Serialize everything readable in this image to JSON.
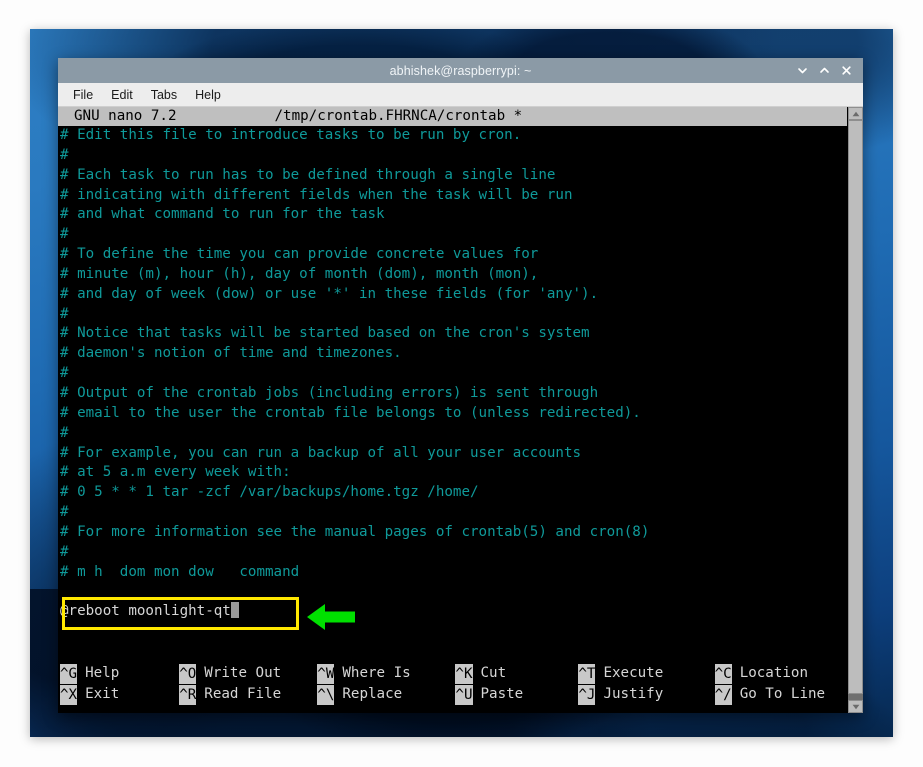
{
  "window": {
    "title": "abhishek@raspberrypi: ~",
    "controls": {
      "minimize": "chevron-down",
      "maximize": "chevron-up",
      "close": "×"
    }
  },
  "menubar": {
    "items": [
      {
        "label": "File"
      },
      {
        "label": "Edit"
      },
      {
        "label": "Tabs"
      },
      {
        "label": "Help"
      }
    ]
  },
  "nano": {
    "version": "GNU nano 7.2",
    "filename": "/tmp/crontab.FHRNCA/crontab *",
    "lines": [
      {
        "text": "# Edit this file to introduce tasks to be run by cron.",
        "style": "comment"
      },
      {
        "text": "#",
        "style": "comment"
      },
      {
        "text": "# Each task to run has to be defined through a single line",
        "style": "comment"
      },
      {
        "text": "# indicating with different fields when the task will be run",
        "style": "comment"
      },
      {
        "text": "# and what command to run for the task",
        "style": "comment"
      },
      {
        "text": "#",
        "style": "comment"
      },
      {
        "text": "# To define the time you can provide concrete values for",
        "style": "comment"
      },
      {
        "text": "# minute (m), hour (h), day of month (dom), month (mon),",
        "style": "comment"
      },
      {
        "text": "# and day of week (dow) or use '*' in these fields (for 'any').",
        "style": "comment"
      },
      {
        "text": "#",
        "style": "comment"
      },
      {
        "text": "# Notice that tasks will be started based on the cron's system",
        "style": "comment"
      },
      {
        "text": "# daemon's notion of time and timezones.",
        "style": "comment"
      },
      {
        "text": "#",
        "style": "comment"
      },
      {
        "text": "# Output of the crontab jobs (including errors) is sent through",
        "style": "comment"
      },
      {
        "text": "# email to the user the crontab file belongs to (unless redirected).",
        "style": "comment"
      },
      {
        "text": "#",
        "style": "comment"
      },
      {
        "text": "# For example, you can run a backup of all your user accounts",
        "style": "comment"
      },
      {
        "text": "# at 5 a.m every week with:",
        "style": "comment"
      },
      {
        "text": "# 0 5 * * 1 tar -zcf /var/backups/home.tgz /home/",
        "style": "comment"
      },
      {
        "text": "#",
        "style": "comment"
      },
      {
        "text": "# For more information see the manual pages of crontab(5) and cron(8)",
        "style": "comment"
      },
      {
        "text": "#",
        "style": "comment"
      },
      {
        "text": "# m h  dom mon dow   command",
        "style": "comment"
      },
      {
        "text": "",
        "style": "comment"
      },
      {
        "text": "@reboot moonlight-qt",
        "style": "cmd",
        "cursor": true
      }
    ],
    "shortcuts": [
      {
        "key": "^G",
        "label": "Help",
        "col": "g"
      },
      {
        "key": "^O",
        "label": "Write Out",
        "col": "o"
      },
      {
        "key": "^W",
        "label": "Where Is",
        "col": "w"
      },
      {
        "key": "^K",
        "label": "Cut",
        "col": "k"
      },
      {
        "key": "^T",
        "label": "Execute",
        "col": "t"
      },
      {
        "key": "^C",
        "label": "Location",
        "col": "c"
      },
      {
        "key": "^X",
        "label": "Exit",
        "col": "g"
      },
      {
        "key": "^R",
        "label": "Read File",
        "col": "o"
      },
      {
        "key": "^\\",
        "label": "Replace",
        "col": "w"
      },
      {
        "key": "^U",
        "label": "Paste",
        "col": "k"
      },
      {
        "key": "^J",
        "label": "Justify",
        "col": "t"
      },
      {
        "key": "^/",
        "label": "Go To Line",
        "col": "c"
      }
    ]
  },
  "annotations": {
    "highlight_rect_color": "#ffe800",
    "arrow_color": "#00e000",
    "arrow_direction": "left",
    "highlighted_text": "@reboot moonlight-qt"
  },
  "colors": {
    "titlebar": "#8b9aa6",
    "menubar": "#ededed",
    "terminal_bg": "#000000",
    "comment_text": "#0f9a9a",
    "command_text": "#d6d6d6",
    "nano_bar_bg": "#bfbfbf"
  }
}
